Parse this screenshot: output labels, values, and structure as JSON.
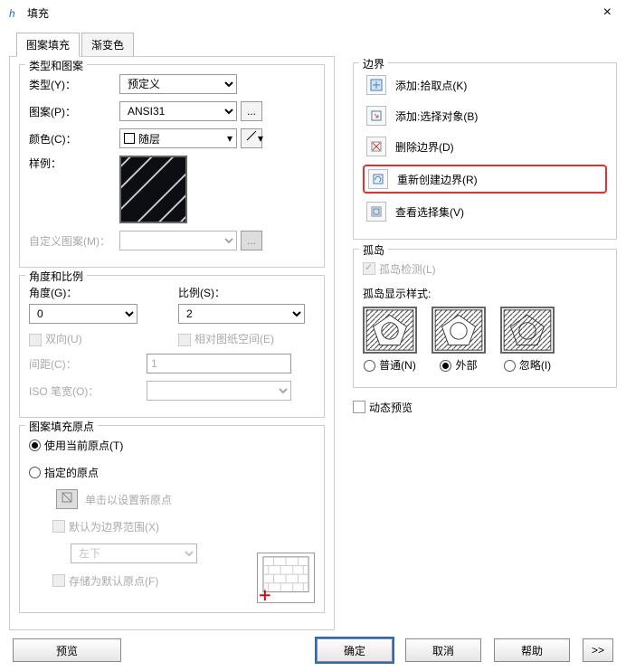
{
  "window": {
    "title": "填充",
    "close": "×",
    "logo": "h"
  },
  "tabs": {
    "pattern": "图案填充",
    "gradient": "渐变色"
  },
  "typeGroup": {
    "title": "类型和图案",
    "typeLabel": "类型(Y)：",
    "typeValue": "预定义",
    "patternLabel": "图案(P)：",
    "patternValue": "ANSI31",
    "patternMore": "...",
    "colorLabel": "颜色(C)：",
    "colorValue": "随层",
    "sampleLabel": "样例：",
    "customLabel": "自定义图案(M)：",
    "customMore": "..."
  },
  "angleGroup": {
    "title": "角度和比例",
    "angleLabel": "角度(G)：",
    "angleValue": "0",
    "scaleLabel": "比例(S)：",
    "scaleValue": "2",
    "bidir": "双向(U)",
    "paperSpace": "相对图纸空间(E)",
    "spacingLabel": "间距(C)：",
    "spacingValue": "1",
    "isoLabel": "ISO 笔宽(O)："
  },
  "originGroup": {
    "title": "图案填充原点",
    "useCurrent": "使用当前原点(T)",
    "specify": "指定的原点",
    "clickNew": "单击以设置新原点",
    "defaultBoundary": "默认为边界范围(X)",
    "position": "左下",
    "storeDefault": "存储为默认原点(F)"
  },
  "boundary": {
    "title": "边界",
    "addPick": "添加:拾取点(K)",
    "addSelect": "添加:选择对象(B)",
    "remove": "删除边界(D)",
    "recreate": "重新创建边界(R)",
    "viewSel": "查看选择集(V)"
  },
  "island": {
    "title": "孤岛",
    "detect": "孤岛检测(L)",
    "styleLabel": "孤岛显示样式:",
    "normal": "普通(N)",
    "outer": "外部",
    "ignore": "忽略(I)"
  },
  "dynamicPreview": "动态预览",
  "footer": {
    "preview": "预览",
    "ok": "确定",
    "cancel": "取消",
    "help": "帮助",
    "expand": ">>"
  }
}
